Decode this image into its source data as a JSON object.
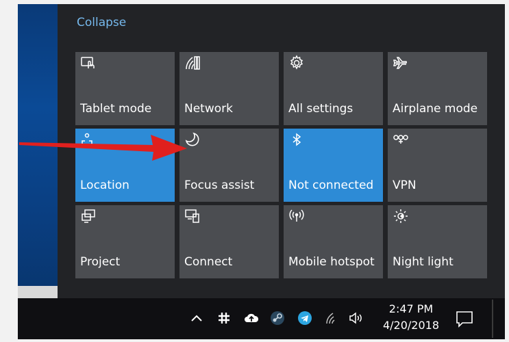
{
  "action_center": {
    "collapse_label": "Collapse",
    "tiles": [
      {
        "label": "Tablet mode",
        "icon": "tablet-mode-icon",
        "active": false
      },
      {
        "label": "Network",
        "icon": "network-icon",
        "active": false
      },
      {
        "label": "All settings",
        "icon": "settings-gear-icon",
        "active": false
      },
      {
        "label": "Airplane mode",
        "icon": "airplane-icon",
        "active": false
      },
      {
        "label": "Location",
        "icon": "location-icon",
        "active": true
      },
      {
        "label": "Focus assist",
        "icon": "moon-icon",
        "active": false
      },
      {
        "label": "Not connected",
        "icon": "bluetooth-icon",
        "active": true
      },
      {
        "label": "VPN",
        "icon": "vpn-icon",
        "active": false
      },
      {
        "label": "Project",
        "icon": "project-icon",
        "active": false
      },
      {
        "label": "Connect",
        "icon": "connect-icon",
        "active": false
      },
      {
        "label": "Mobile hotspot",
        "icon": "mobile-hotspot-icon",
        "active": false
      },
      {
        "label": "Night light",
        "icon": "night-light-icon",
        "active": false
      }
    ]
  },
  "taskbar": {
    "tray_icons": [
      "chevron-up-icon",
      "slack-icon",
      "cloud-upload-icon",
      "steam-icon",
      "telegram-icon",
      "wifi-icon",
      "volume-icon"
    ],
    "time": "2:47 PM",
    "date": "4/20/2018",
    "notification_icon": "action-center-icon"
  },
  "colors": {
    "panel_bg": "#222326",
    "tile_bg": "#4b4d51",
    "tile_active_bg": "#2d8bd6",
    "link": "#76b9ed",
    "annotation_arrow": "#e0201e"
  }
}
